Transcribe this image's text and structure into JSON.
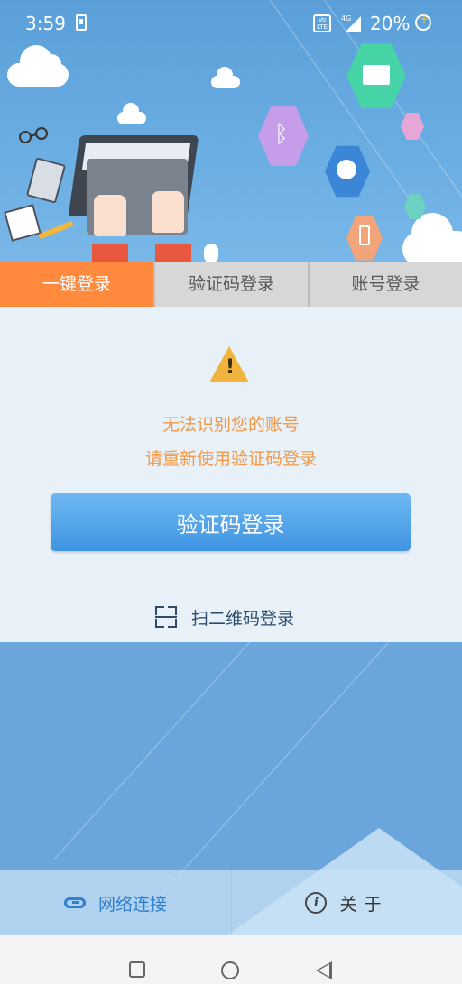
{
  "status_bar": {
    "time": "3:59",
    "volte": "Vo LTE",
    "network": "4G",
    "battery": "20%"
  },
  "tabs": [
    {
      "label": "一键登录",
      "active": true
    },
    {
      "label": "验证码登录",
      "active": false
    },
    {
      "label": "账号登录",
      "active": false
    }
  ],
  "message": {
    "line1": "无法识别您的账号",
    "line2": "请重新使用验证码登录"
  },
  "sms_login_button": "验证码登录",
  "qr_login": "扫二维码登录",
  "bottom_bar": {
    "network": "网络连接",
    "about": "关于"
  },
  "colors": {
    "accent_orange": "#ff8a3d",
    "primary_blue": "#3f94e2",
    "message_orange": "#f09a4a",
    "background_blue": "#6aa6dc"
  },
  "icons": [
    "warning-icon",
    "qr-scan-icon",
    "link-icon",
    "info-icon",
    "nav-recents-icon",
    "nav-home-icon",
    "nav-back-icon"
  ]
}
